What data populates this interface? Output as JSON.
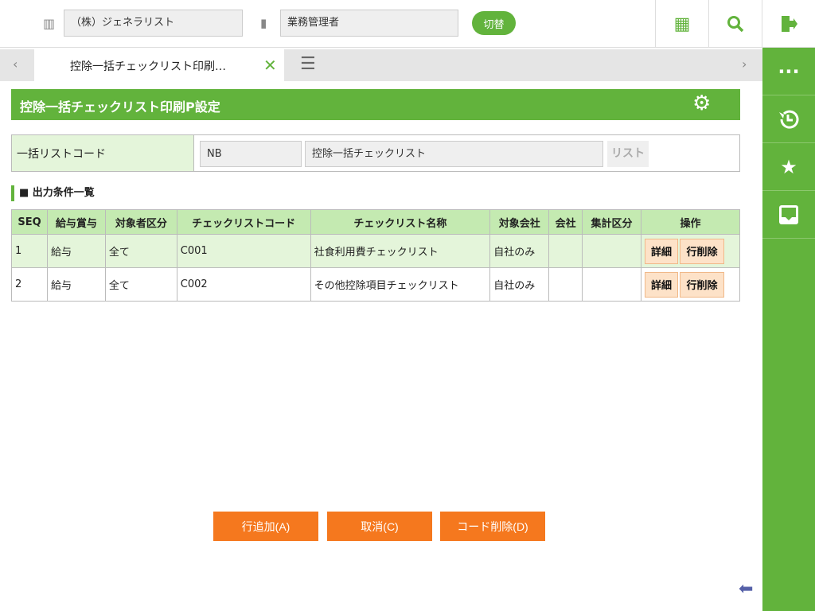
{
  "header": {
    "company": "（株）ジェネラリスト",
    "role": "業務管理者",
    "switch_label": "切替"
  },
  "tabs": {
    "active": "控除一括チェックリスト印刷…",
    "prev": "‹",
    "next": "›"
  },
  "page": {
    "title": "控除一括チェックリスト印刷P設定"
  },
  "form": {
    "label": "一括リストコード",
    "code": "NB",
    "name": "控除一括チェックリスト",
    "list_button": "リスト"
  },
  "section": {
    "title": "■ 出力条件一覧"
  },
  "table": {
    "headers": [
      "SEQ",
      "給与賞与",
      "対象者区分",
      "チェックリストコード",
      "チェックリスト名称",
      "対象会社",
      "会社",
      "集計区分",
      "操作"
    ],
    "rows": [
      {
        "seq": "1",
        "type": "給与",
        "target": "全て",
        "code": "C001",
        "name": "社食利用費チェックリスト",
        "company_scope": "自社のみ",
        "company": "",
        "summary": "",
        "detail": "詳細",
        "delete": "行削除"
      },
      {
        "seq": "2",
        "type": "給与",
        "target": "全て",
        "code": "C002",
        "name": "その他控除項目チェックリスト",
        "company_scope": "自社のみ",
        "company": "",
        "summary": "",
        "detail": "詳細",
        "delete": "行削除"
      }
    ]
  },
  "footer": {
    "add": "行追加(A)",
    "cancel": "取消(C)",
    "delete_code": "コード削除(D)"
  },
  "colors": {
    "green": "#62b33c",
    "orange": "#f5781e"
  }
}
